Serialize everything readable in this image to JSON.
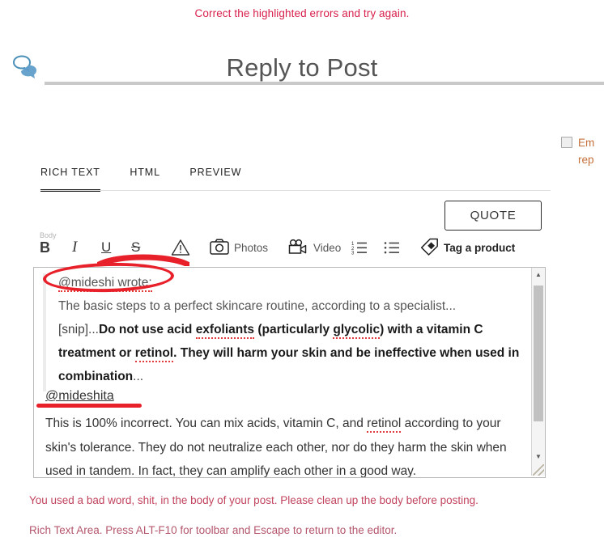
{
  "top_error": "Correct the highlighted errors and try again.",
  "header": {
    "icon": "speech-bubbles-icon",
    "title": "Reply to Post"
  },
  "email_option": {
    "checked": false,
    "label": "Em\nrep"
  },
  "tabs": [
    {
      "label": "RICH TEXT",
      "active": true
    },
    {
      "label": "HTML",
      "active": false
    },
    {
      "label": "PREVIEW",
      "active": false
    }
  ],
  "quote_button": "QUOTE",
  "toolbar": {
    "body_tag": "Body",
    "items": [
      {
        "name": "bold-button",
        "glyph": "B",
        "label": ""
      },
      {
        "name": "italic-button",
        "glyph": "I",
        "label": ""
      },
      {
        "name": "underline-button",
        "glyph": "U",
        "label": ""
      },
      {
        "name": "strikethrough-button",
        "glyph": "S",
        "label": ""
      },
      {
        "name": "warning-icon",
        "glyph": "",
        "label": ""
      },
      {
        "name": "photos-button",
        "glyph": "",
        "label": "Photos"
      },
      {
        "name": "video-button",
        "glyph": "",
        "label": "Video"
      },
      {
        "name": "ordered-list-button",
        "glyph": "",
        "label": ""
      },
      {
        "name": "unordered-list-button",
        "glyph": "",
        "label": ""
      },
      {
        "name": "tag-a-product-button",
        "glyph": "",
        "label": "Tag a product"
      }
    ]
  },
  "editor": {
    "quote": {
      "attribution": "@mideshi wrote:",
      "line1": "The basic steps to a perfect skincare routine, according to a specialist...",
      "snip_prefix": "[snip]...",
      "bold_text": "Do not use acid exfoliants (particularly glycolic) with a vitamin C treatment or retinol. They will harm your skin and be ineffective when used in combination",
      "trailing": "..."
    },
    "reply": {
      "handle": "@mideshita",
      "text": "This is 100% incorrect. You can mix acids, vitamin C, and retinol according to your skin's tolerance. They do not neutralize each other, nor do they harm the skin when used in tandem. In fact, they can amplify each other in a good way."
    },
    "spellcheck_words": [
      "@mideshi",
      "exfoliants",
      "glycolic",
      "retinol",
      "@mideshita"
    ]
  },
  "messages": {
    "bad_word": "You used a bad word, shit, in the body of your post. Please clean up the body before posting.",
    "hint": "Rich Text Area. Press ALT-F10 for toolbar and Escape to return to the editor."
  },
  "colors": {
    "error_red": "#d81e4a",
    "message_red": "#c2445e",
    "ink_red": "#e8202a",
    "accent_blue": "#4a90b8",
    "title_gray": "#555555"
  }
}
